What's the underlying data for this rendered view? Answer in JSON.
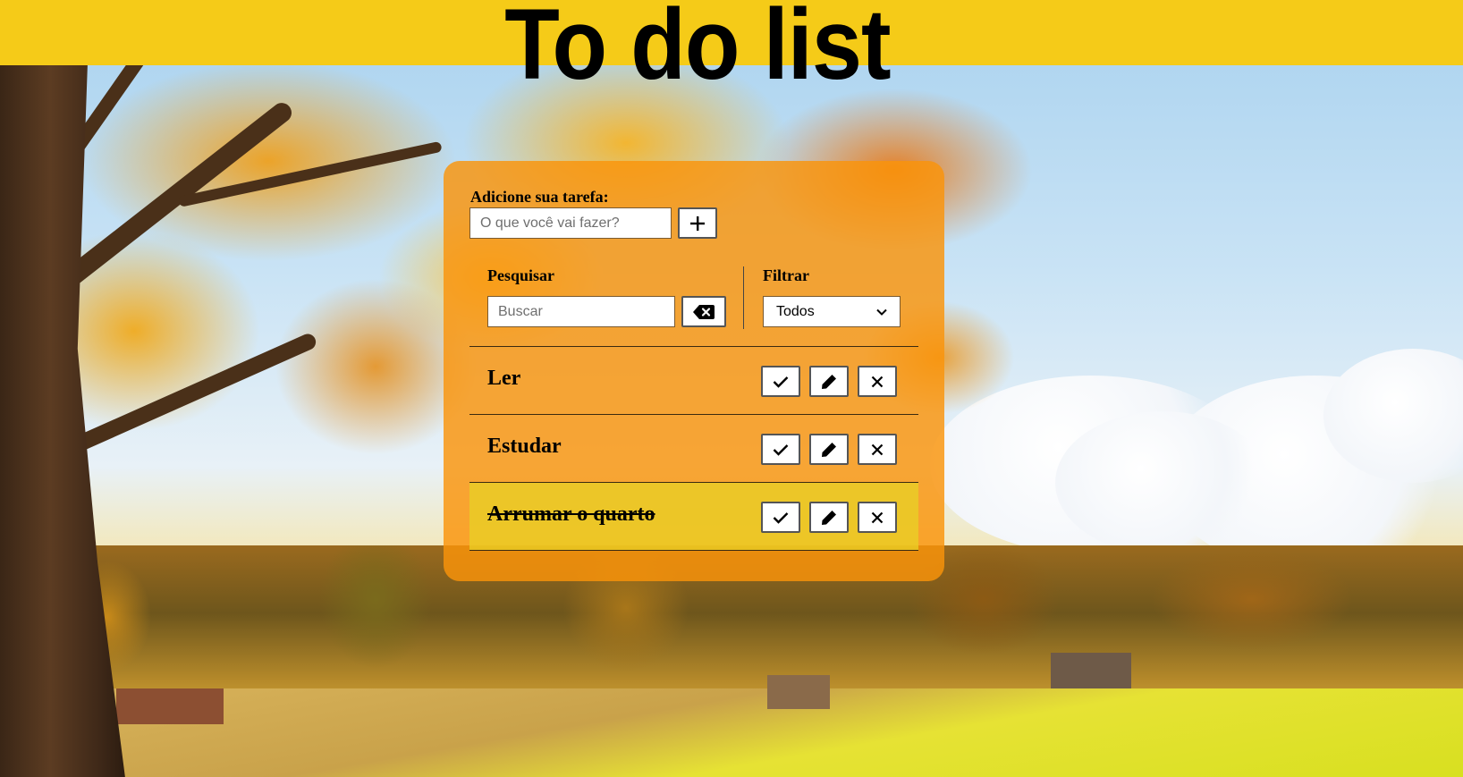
{
  "header": {
    "title": "To do list"
  },
  "add_form": {
    "label": "Adicione sua tarefa:",
    "placeholder": "O que você vai fazer?",
    "value": "",
    "add_icon": "plus-icon"
  },
  "search": {
    "label": "Pesquisar",
    "placeholder": "Buscar",
    "value": "",
    "erase_icon": "backspace-icon"
  },
  "filter": {
    "label": "Filtrar",
    "selected": "Todos"
  },
  "todos": [
    {
      "title": "Ler",
      "done": false
    },
    {
      "title": "Estudar",
      "done": false
    },
    {
      "title": "Arrumar o quarto",
      "done": true
    }
  ],
  "todo_actions": {
    "finish_icon": "check-icon",
    "edit_icon": "pencil-icon",
    "remove_icon": "close-icon"
  },
  "colors": {
    "header_bg": "#f5cb18",
    "panel_bg": "#fa940a",
    "done_row_bg": "#e8d226"
  }
}
